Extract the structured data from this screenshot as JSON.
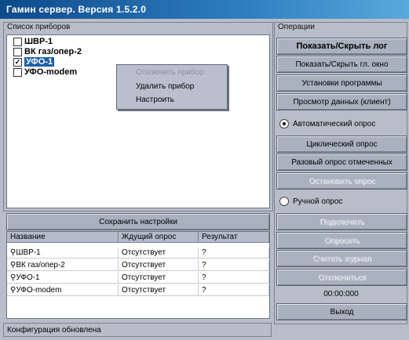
{
  "window": {
    "title": "Гамин сервер. Версия 1.5.2.0"
  },
  "device_list": {
    "label": "Список приборов",
    "items": [
      {
        "name": "ШВР-1",
        "checked": false,
        "selected": false
      },
      {
        "name": "ВК газ/опер-2",
        "checked": false,
        "selected": false
      },
      {
        "name": "УФО-1",
        "checked": true,
        "selected": true
      },
      {
        "name": "УФО-modem",
        "checked": false,
        "selected": false
      }
    ]
  },
  "context_menu": {
    "items": [
      {
        "label": "Отключить прибор",
        "disabled": true
      },
      {
        "label": "Удалить прибор",
        "disabled": false
      },
      {
        "label": "Настроить",
        "disabled": false
      }
    ]
  },
  "save_settings_label": "Сохранить настройки",
  "table": {
    "headers": [
      "Название",
      "Ждущий опрос",
      "Результат"
    ],
    "rows": [
      [
        "ШВР-1",
        "Отсутствует",
        "?"
      ],
      [
        "ВК газ/опер-2",
        "Отсутствует",
        "?"
      ],
      [
        "УФО-1",
        "Отсутствует",
        "?"
      ],
      [
        "УФО-modem",
        "Отсутствует",
        "?"
      ]
    ]
  },
  "status_text": "Конфигурация обновлена",
  "operations": {
    "label": "Операции",
    "buttons": [
      {
        "label": "Показать/Скрыть лог",
        "bold": true,
        "disabled": false
      },
      {
        "label": "Показать/Скрыть гл. окно",
        "bold": false,
        "disabled": false
      },
      {
        "label": "Установки программы",
        "bold": false,
        "disabled": false
      },
      {
        "label": "Просмотр данных (клиент)",
        "bold": false,
        "disabled": false
      }
    ],
    "auto_poll": {
      "label": "Автоматический опрос",
      "selected": true,
      "buttons": [
        {
          "label": "Циклический опрос",
          "disabled": false
        },
        {
          "label": "Разовый опрос отмеченных",
          "disabled": false
        },
        {
          "label": "Остановить опрос",
          "disabled": true
        }
      ]
    },
    "manual_poll": {
      "label": "Ручной опрос",
      "selected": false,
      "buttons": [
        {
          "label": "Подключить",
          "disabled": true
        },
        {
          "label": "Опросить",
          "disabled": true
        },
        {
          "label": "Считать журнал",
          "disabled": true
        },
        {
          "label": "Отключиться",
          "disabled": true
        }
      ]
    },
    "timer": "00:00:000",
    "exit_label": "Выход"
  }
}
